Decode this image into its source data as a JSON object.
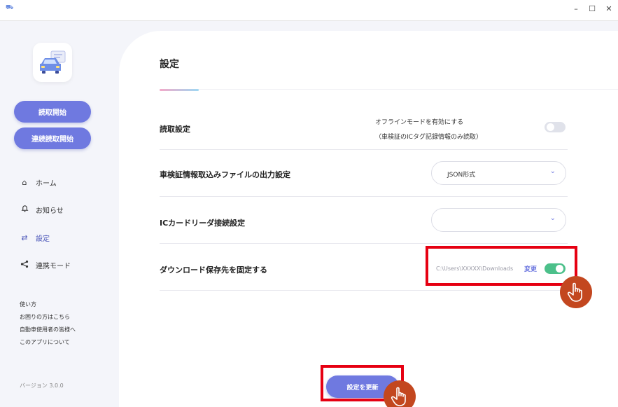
{
  "window": {
    "app_icon": "car-app-icon",
    "minimize_glyph": "–",
    "maximize_glyph": "☐",
    "close_glyph": "✕"
  },
  "sidebar": {
    "logo_icon": "car-logo-icon",
    "read_start_label": "読取開始",
    "continuous_read_label": "連続読取開始",
    "nav": [
      {
        "label": "ホーム",
        "icon": "home-icon"
      },
      {
        "label": "お知らせ",
        "icon": "bell-icon"
      },
      {
        "label": "設定",
        "icon": "settings-arrows-icon"
      },
      {
        "label": "連携モード",
        "icon": "share-icon"
      }
    ],
    "links": [
      "使い方",
      "お困りの方はこちら",
      "自動車使用者の皆様へ",
      "このアプリについて"
    ],
    "version": "バージョン  3.0.0"
  },
  "main": {
    "title": "設定",
    "rows": {
      "read": {
        "label": "読取設定",
        "offline_line1": "オフラインモードを有効にする",
        "offline_line2": "（車検証のICタグ記録情報のみ読取）",
        "offline_enabled": false
      },
      "output": {
        "label": "車検証情報取込みファイルの出力設定",
        "format_value": "JSON形式"
      },
      "reader": {
        "label": "ICカードリーダ接続設定",
        "value": ""
      },
      "download": {
        "label": "ダウンロード保存先を固定する",
        "path": "C:\\Users\\XXXXX\\Downloads",
        "change_label": "変更",
        "fixed_enabled": true
      }
    },
    "submit_label": "設定を更新"
  },
  "colors": {
    "accent": "#6f79e0",
    "toggle_on": "#4cc08a",
    "highlight": "#e60012",
    "hand_cursor": "#c3471f"
  }
}
